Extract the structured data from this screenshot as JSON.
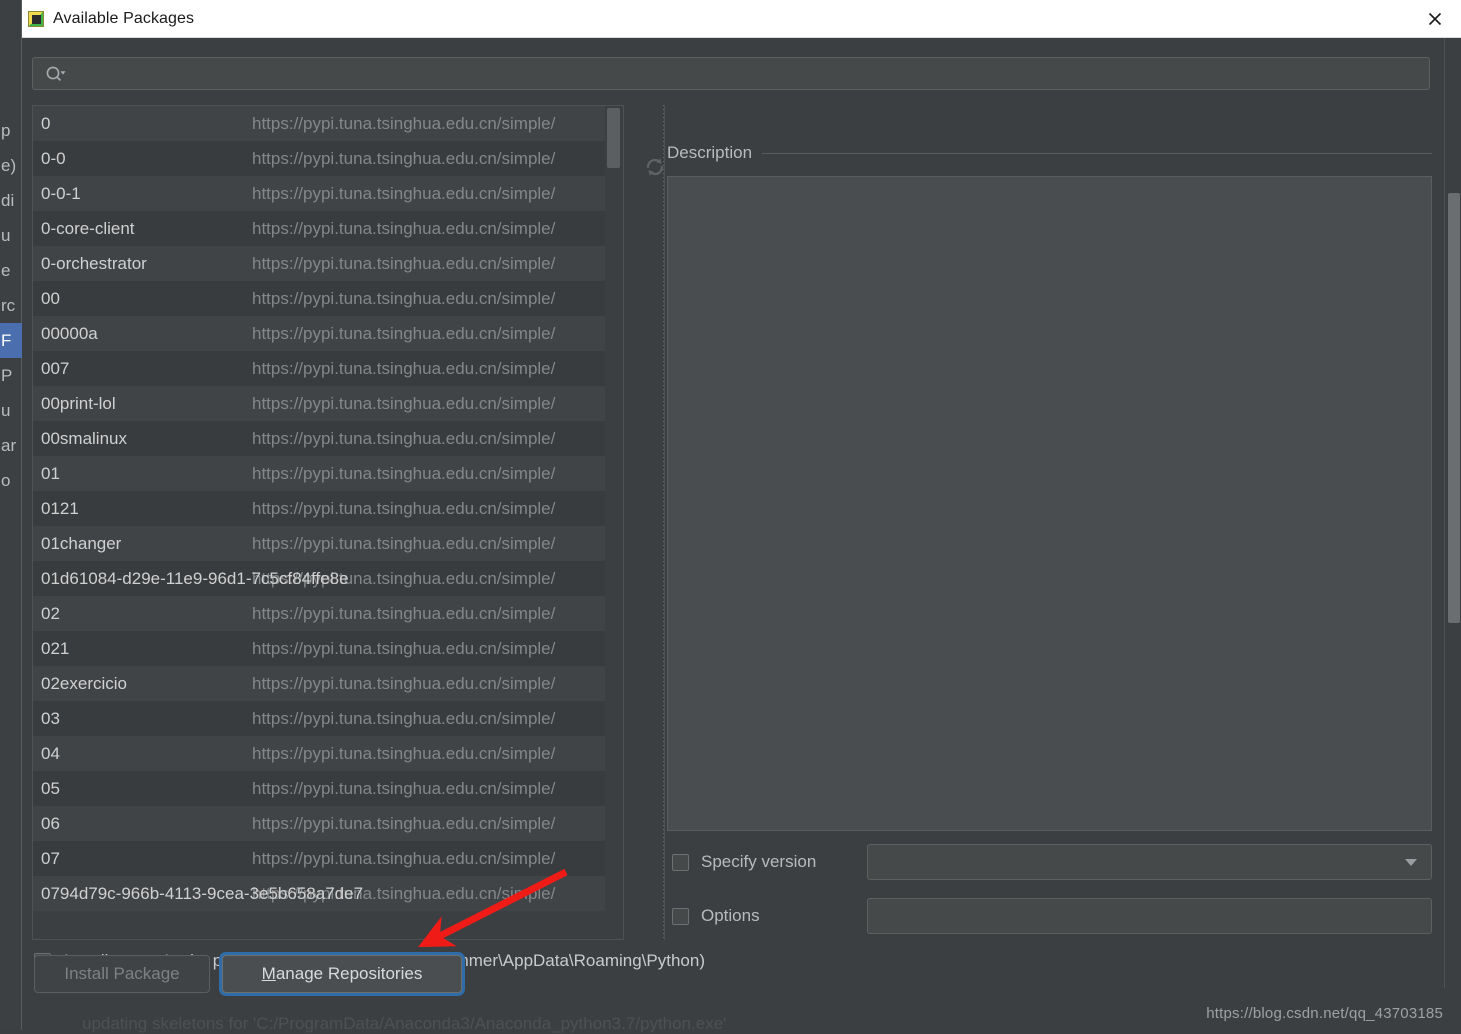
{
  "window": {
    "title": "Available Packages",
    "icon": "python-package-icon",
    "close_icon": "close-icon"
  },
  "search": {
    "value": "",
    "placeholder": "",
    "icon": "search-icon"
  },
  "list": {
    "refresh_icon": "refresh-icon",
    "repository_url": "https://pypi.tuna.tsinghua.edu.cn/simple/",
    "packages": [
      "0",
      "0-0",
      "0-0-1",
      "0-core-client",
      "0-orchestrator",
      "00",
      "00000a",
      "007",
      "00print-lol",
      "00smalinux",
      "01",
      "0121",
      "01changer",
      "01d61084-d29e-11e9-96d1-7c5cf84ffe8e",
      "02",
      "021",
      "02exercicio",
      "03",
      "04",
      "05",
      "06",
      "07",
      "0794d79c-966b-4113-9cea-3e5b658a7de7"
    ]
  },
  "description": {
    "title": "Description",
    "body": ""
  },
  "options": {
    "specify_version": {
      "label": "Specify version",
      "checked": false,
      "value": ""
    },
    "extra_options": {
      "label": "Options",
      "checked": false,
      "value": ""
    }
  },
  "user_site": {
    "label": "Install to user's site packages directory (C:\\Users\\summer\\AppData\\Roaming\\Python)",
    "checked": false
  },
  "buttons": {
    "install": {
      "label": "Install Package",
      "enabled": false
    },
    "manage": {
      "label": "Manage Repositories",
      "mnemonic": "M",
      "rest": "anage Repositories",
      "focused": true
    }
  },
  "background_window": {
    "fragments": [
      "p",
      "e)",
      "di",
      "u",
      "e",
      "rc",
      "F",
      "P",
      "u",
      "ar",
      "o"
    ],
    "selected_index": 6
  },
  "watermark": "https://blog.csdn.net/qq_43703185",
  "ghost_line": "updating skeletons for 'C:/ProgramData/Anaconda3/Anaconda_python3.7/python.exe'",
  "colors": {
    "dialog_bg": "#3c3f41",
    "row_odd": "#414447",
    "row_even": "#393c3e",
    "description_bg": "#4a4d4f",
    "focus_ring": "#2f6ca8",
    "selection_blue": "#4b6eaf",
    "annotation_red": "#ee1b17",
    "titlebar_bg": "#ffffff"
  }
}
